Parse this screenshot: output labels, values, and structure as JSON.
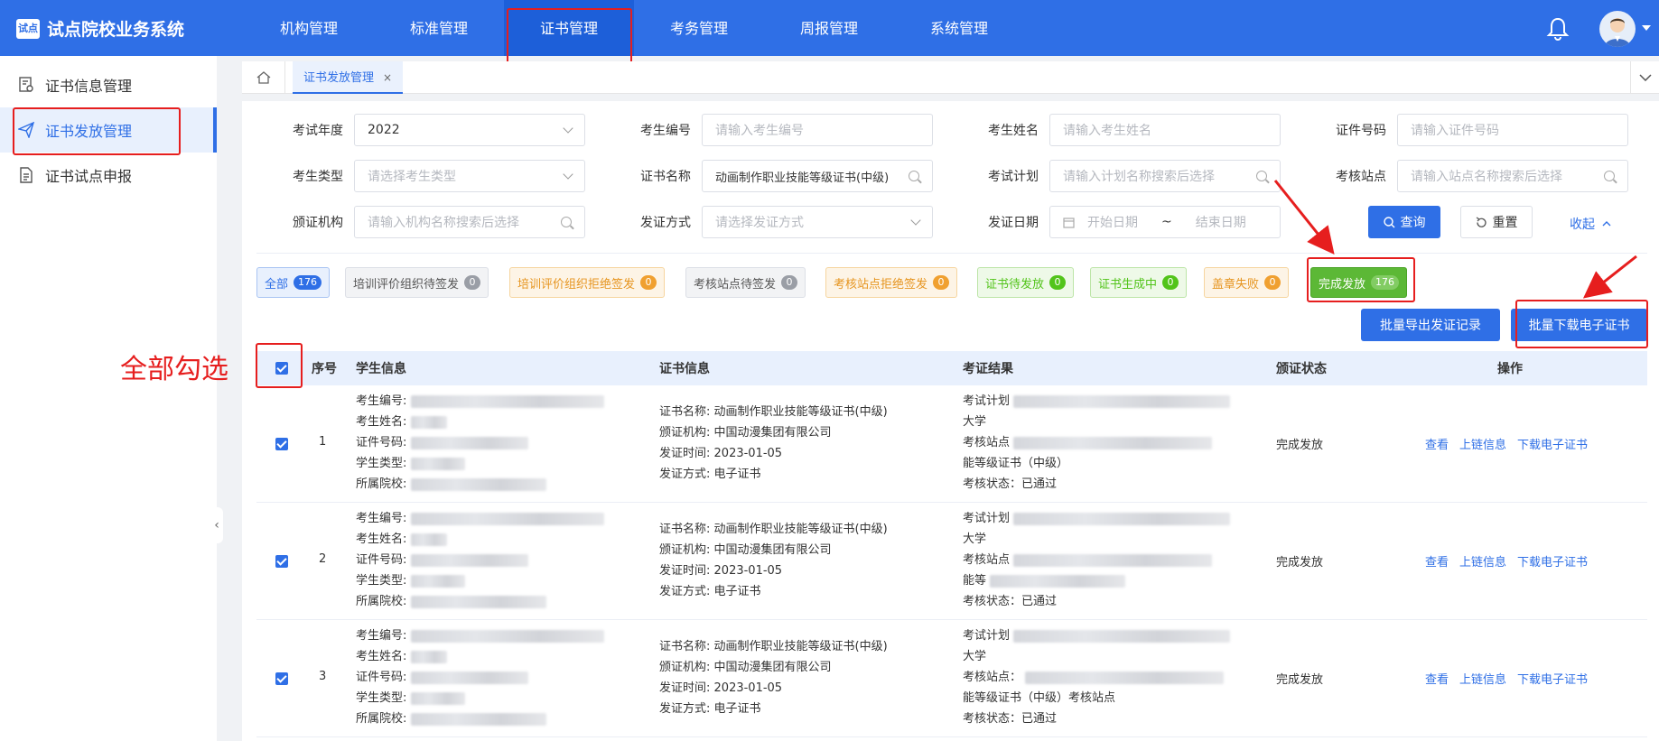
{
  "app": {
    "title": "试点院校业务系统",
    "logo_text": "试点"
  },
  "nav": [
    {
      "label": "机构管理"
    },
    {
      "label": "标准管理"
    },
    {
      "label": "证书管理"
    },
    {
      "label": "考务管理"
    },
    {
      "label": "周报管理"
    },
    {
      "label": "系统管理"
    }
  ],
  "sidebar": [
    {
      "label": "证书信息管理",
      "icon": "certificate-list-icon"
    },
    {
      "label": "证书发放管理",
      "icon": "paper-plane-icon"
    },
    {
      "label": "证书试点申报",
      "icon": "document-icon"
    }
  ],
  "tabs": {
    "active_label": "证书发放管理",
    "close": "×"
  },
  "filters": {
    "year_label": "考试年度",
    "year_value": "2022",
    "exam_no_label": "考生编号",
    "exam_no_ph": "请输入考生编号",
    "name_label": "考生姓名",
    "name_ph": "请输入考生姓名",
    "cert_no_label": "证件号码",
    "cert_no_ph": "请输入证件号码",
    "type_label": "考生类型",
    "type_ph": "请选择考生类型",
    "cert_name_label": "证书名称",
    "cert_name_value": "动画制作职业技能等级证书(中级)",
    "plan_label": "考试计划",
    "plan_ph": "请输入计划名称搜索后选择",
    "site_label": "考核站点",
    "site_ph": "请输入站点名称搜索后选择",
    "org_label": "颁证机构",
    "org_ph": "请输入机构名称搜索后选择",
    "method_label": "发证方式",
    "method_ph": "请选择发证方式",
    "date_label": "发证日期",
    "date_start_ph": "开始日期",
    "date_sep": "~",
    "date_end_ph": "结束日期",
    "search_btn": "查询",
    "reset_btn": "重置",
    "collapse_link": "收起"
  },
  "status_tabs": [
    {
      "label": "全部",
      "count": "176",
      "style": "blue"
    },
    {
      "label": "培训评价组织待签发",
      "count": "0",
      "style": "gray"
    },
    {
      "label": "培训评价组织拒绝签发",
      "count": "0",
      "style": "orange"
    },
    {
      "label": "考核站点待签发",
      "count": "0",
      "style": "gray"
    },
    {
      "label": "考核站点拒绝签发",
      "count": "0",
      "style": "orange"
    },
    {
      "label": "证书待发放",
      "count": "0",
      "style": "green"
    },
    {
      "label": "证书生成中",
      "count": "0",
      "style": "green"
    },
    {
      "label": "盖章失败",
      "count": "0",
      "style": "orange"
    },
    {
      "label": "完成发放",
      "count": "176",
      "style": "solid-green"
    }
  ],
  "actions": {
    "export_btn": "批量导出发证记录",
    "download_btn": "批量下载电子证书"
  },
  "annotation": {
    "select_all_text": "全部勾选"
  },
  "table": {
    "headers": {
      "index": "序号",
      "student": "学生信息",
      "cert": "证书信息",
      "result": "考证结果",
      "status": "颁证状态",
      "ops": "操作"
    },
    "student_labels": [
      "考生编号:",
      "考生姓名:",
      "证件号码:",
      "学生类型:",
      "所属院校:"
    ],
    "cert_labels": [
      "证书名称:",
      "颁证机构:",
      "发证时间:",
      "发证方式:"
    ],
    "rows": [
      {
        "index": "1",
        "cert": [
          "动画制作职业技能等级证书(中级)",
          "中国动漫集团有限公司",
          "2023-01-05",
          "电子证书"
        ],
        "result": [
          "考试计划",
          "大学",
          "考核站点",
          "能等级证书（中级）",
          "考核状态：已通过"
        ],
        "status": "完成发放",
        "ops": [
          "查看",
          "上链信息",
          "下载电子证书"
        ]
      },
      {
        "index": "2",
        "cert": [
          "动画制作职业技能等级证书(中级)",
          "中国动漫集团有限公司",
          "2023-01-05",
          "电子证书"
        ],
        "result": [
          "考试计划",
          "大学",
          "考核站点",
          "能等",
          "考核状态：已通过"
        ],
        "status": "完成发放",
        "ops": [
          "查看",
          "上链信息",
          "下载电子证书"
        ]
      },
      {
        "index": "3",
        "cert": [
          "动画制作职业技能等级证书(中级)",
          "中国动漫集团有限公司",
          "2023-01-05",
          "电子证书"
        ],
        "result": [
          "考试计划",
          "大学",
          "考核站点：",
          "能等级证书（中级）考核站点",
          "考核状态：已通过"
        ],
        "status": "完成发放",
        "ops": [
          "查看",
          "上链信息",
          "下载电子证书"
        ]
      }
    ]
  },
  "colors": {
    "primary": "#2f6fe6",
    "success": "#52c41a",
    "warning": "#f0a030",
    "annotation": "#e61e1e"
  }
}
